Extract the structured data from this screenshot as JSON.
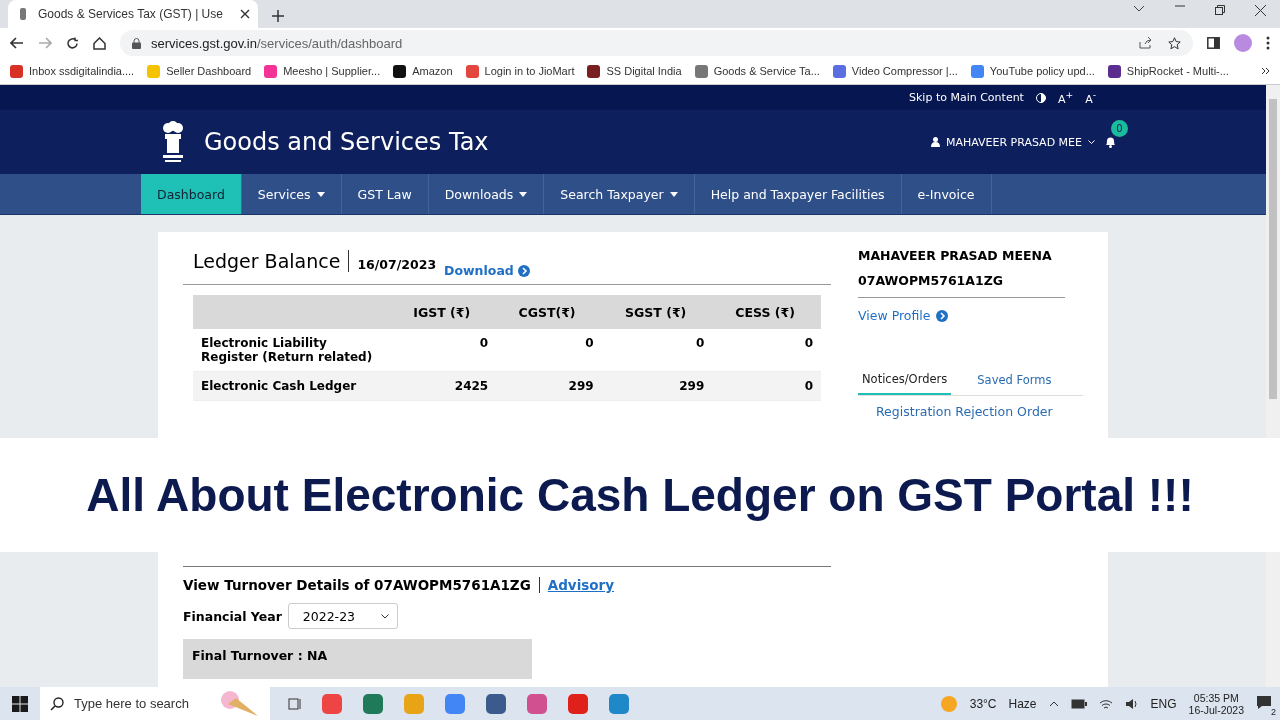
{
  "browser": {
    "tab": {
      "title": "Goods & Services Tax (GST) | Use"
    },
    "url": {
      "host": "services.gst.gov.in",
      "path": "/services/auth/dashboard"
    },
    "bookmarks": [
      {
        "label": "Inbox ssdigitalindia....",
        "color": "#d93025"
      },
      {
        "label": "Seller Dashboard",
        "color": "#f6c300"
      },
      {
        "label": "Meesho | Supplier...",
        "color": "#f43397"
      },
      {
        "label": "Amazon",
        "color": "#111111"
      },
      {
        "label": "Login in to JioMart",
        "color": "#e2463f"
      },
      {
        "label": "SS Digital India",
        "color": "#7a1f1f"
      },
      {
        "label": "Goods & Service Ta...",
        "color": "#777777"
      },
      {
        "label": "Video Compressor |...",
        "color": "#5b6ee1"
      },
      {
        "label": "YouTube policy upd...",
        "color": "#4285f4"
      },
      {
        "label": "ShipRocket - Multi-...",
        "color": "#5b2d8e"
      }
    ]
  },
  "site": {
    "top_bar": {
      "skip": "Skip to Main Content",
      "font_up": "A$^{+}$",
      "font_down": "A$^{-}$"
    },
    "header": {
      "title": "Goods and Services Tax",
      "user": "MAHAVEER PRASAD MEE",
      "notifications": "0"
    },
    "nav": [
      {
        "label": "Dashboard",
        "selected": true,
        "dropdown": false
      },
      {
        "label": "Services",
        "selected": false,
        "dropdown": true
      },
      {
        "label": "GST Law",
        "selected": false,
        "dropdown": false
      },
      {
        "label": "Downloads",
        "selected": false,
        "dropdown": true
      },
      {
        "label": "Search Taxpayer",
        "selected": false,
        "dropdown": true
      },
      {
        "label": "Help and Taxpayer Facilities",
        "selected": false,
        "dropdown": false
      },
      {
        "label": "e-Invoice",
        "selected": false,
        "dropdown": false
      }
    ],
    "ledger": {
      "title": "Ledger Balance",
      "date": "16/07/2023",
      "download": "Download",
      "columns": [
        "IGST (₹)",
        "CGST(₹)",
        "SGST (₹)",
        "CESS (₹)"
      ],
      "rows": [
        {
          "label": "Electronic Liability Register (Return related)",
          "values": [
            "0",
            "0",
            "0",
            "0"
          ]
        },
        {
          "label": "Electronic Cash Ledger",
          "values": [
            "2425",
            "299",
            "299",
            "0"
          ]
        }
      ]
    },
    "profile": {
      "name": "MAHAVEER PRASAD MEENA",
      "gstin": "07AWOPM5761A1ZG",
      "view_profile": "View Profile",
      "tabs": [
        {
          "label": "Notices/Orders",
          "selected": true
        },
        {
          "label": "Saved Forms",
          "selected": false
        }
      ],
      "notices": [
        "Registration Rejection Order"
      ]
    },
    "turnover": {
      "title": "View Turnover Details of 07AWOPM5761A1ZG",
      "advisory": "Advisory",
      "year_label": "Financial Year",
      "year": "2022-23",
      "final": "Final Turnover : NA"
    }
  },
  "banner": {
    "text": "All About Electronic Cash Ledger on GST Portal !!!"
  },
  "taskbar": {
    "search": "Type here to search",
    "temperature": "33°C",
    "weather": "Haze",
    "language": "ENG",
    "time": "05:35 PM",
    "date": "16-Jul-2023",
    "notifications": "2"
  }
}
